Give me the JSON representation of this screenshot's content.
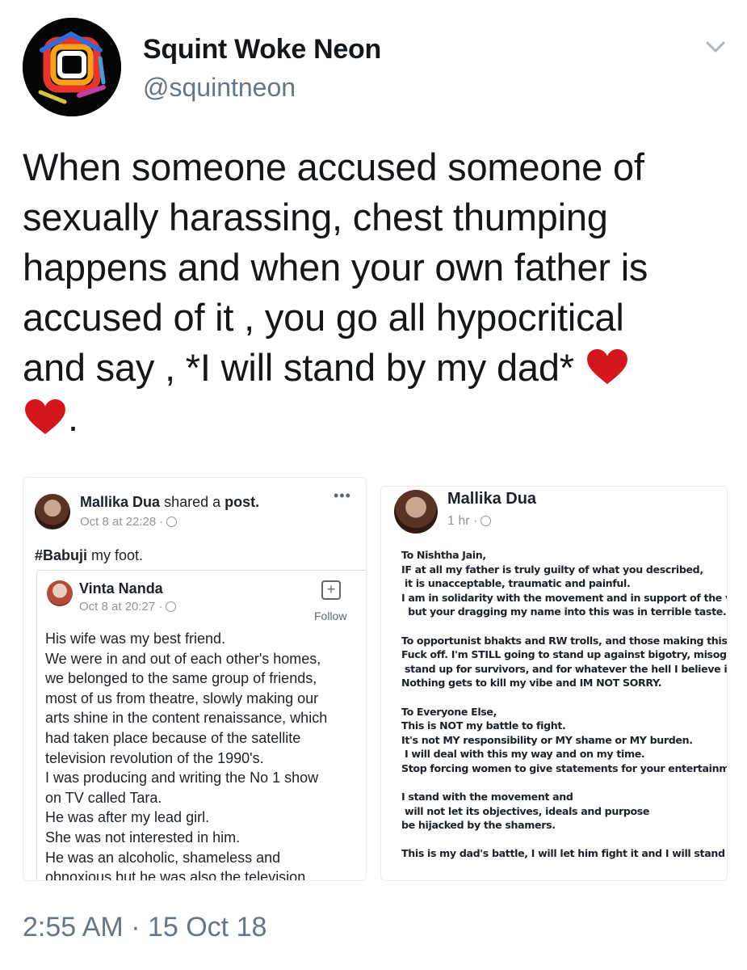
{
  "tweet": {
    "display_name": "Squint Woke Neon",
    "handle": "@squintneon",
    "text_lines": [
      "When someone accused someone of",
      "sexually harassing, chest thumping",
      "happens and when your own father is",
      "accused of it , you go all hypocritical",
      "and say , *I will stand by my dad* "
    ],
    "text_tail": ".",
    "timestamp": "2:55 AM · 15 Oct 18",
    "heart_color": "#d2161c"
  },
  "left_post": {
    "author": "Mallika Dua",
    "action_prefix": "shared a",
    "action_object": "post.",
    "meta": "Oct 8 at 22:28 ·",
    "caption_hashtag": "#Babuji",
    "caption_rest": " my foot.",
    "shared": {
      "author": "Vinta Nanda",
      "meta": "Oct 8 at 20:27 ·",
      "follow_label": "Follow",
      "lines": [
        "His wife was my best friend.",
        "We were in and out of each other's homes,",
        "we belonged to the same group of friends,",
        "most of us from theatre, slowly making our",
        "arts shine in the content renaissance, which",
        "had taken place because of the satellite",
        "television revolution of the 1990's.",
        "I was producing and writing the No 1 show",
        "on TV called Tara.",
        "He was after my lead girl.",
        "She was not interested in him.",
        "He was an alcoholic, shameless and",
        "obnoxious but he was also the television"
      ]
    }
  },
  "right_post": {
    "author": "Mallika Dua",
    "meta": "1 hr ·",
    "letter": [
      "To Nishtha Jain,",
      "IF at all my father is truly  guilty of what you described,",
      " it is unacceptable, traumatic and painful.",
      "I am in solidarity with the movement and in support of the voices",
      "  but your dragging my name into this was in terrible taste.",
      "",
      "To opportunist bhakts and RW trolls, and those making this about",
      "Fuck off. I'm STILL going to stand up against bigotry, misogyny,",
      " stand up for survivors, and for whatever the hell I believe in.",
      "Nothing gets to kill my vibe and IM NOT SORRY.",
      "",
      "To Everyone Else,",
      "This is NOT my battle to fight.",
      "It's not MY  responsibility or MY shame or MY burden.",
      " I will deal with this my way and on my time.",
      "Stop forcing women to give statements for your entertainment.",
      "",
      "I stand with the movement and",
      " will not let its objectives, ideals and purpose",
      "be hijacked by the shamers.",
      "",
      "This is my dad's battle, I will let him fight it and I will stand by him."
    ]
  }
}
